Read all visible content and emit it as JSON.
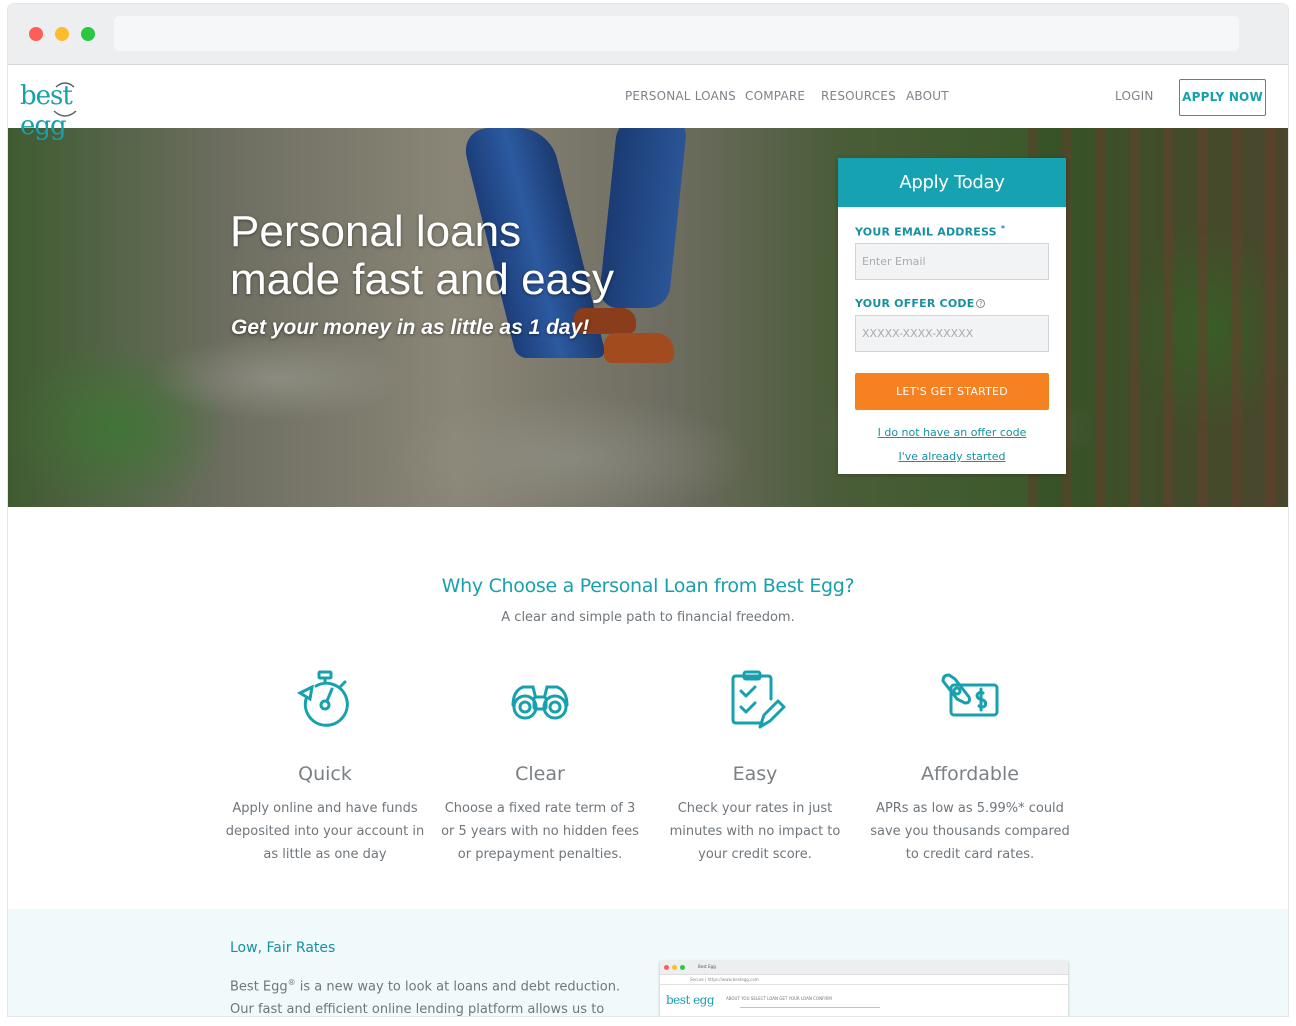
{
  "browser": {
    "url": ""
  },
  "brand": {
    "logo_text": "best egg",
    "accent": "#17a0ad",
    "cta_orange": "#f68121"
  },
  "nav": {
    "items": [
      "PERSONAL LOANS",
      "COMPARE",
      "RESOURCES",
      "ABOUT"
    ],
    "login": "LOGIN",
    "apply": "APPLY NOW"
  },
  "hero": {
    "headline_line1": "Personal loans",
    "headline_line2": "made fast and easy",
    "subheadline": "Get your money in as little as 1 day!"
  },
  "apply_form": {
    "title": "Apply Today",
    "email_label": "YOUR EMAIL ADDRESS",
    "email_required_mark": "*",
    "email_placeholder": "Enter Email",
    "offer_label": "YOUR OFFER CODE",
    "offer_help_glyph": "?",
    "offer_placeholder": "XXXXX-XXXX-XXXXX",
    "submit": "LET'S GET STARTED",
    "link_no_code": "I do not have an offer code",
    "link_started": "I've already started"
  },
  "why": {
    "title": "Why Choose a Personal Loan from Best Egg?",
    "tagline": "A clear and simple path to financial freedom.",
    "features": [
      {
        "icon": "stopwatch-icon",
        "title": "Quick",
        "text": "Apply online and have funds deposited into your account in as little as one day"
      },
      {
        "icon": "binoculars-icon",
        "title": "Clear",
        "text": "Choose a fixed rate term of 3 or 5 years with no hidden fees or prepayment penalties."
      },
      {
        "icon": "clipboard-check-icon",
        "title": "Easy",
        "text": "Check your rates in just minutes with no impact to your credit score."
      },
      {
        "icon": "money-tag-icon",
        "title": "Affordable",
        "text": "APRs as low as 5.99%* could save you thousands compared to credit card rates."
      }
    ]
  },
  "rates": {
    "title": "Low, Fair Rates",
    "text_brand": "Best Egg",
    "text_mark": "®",
    "text_rest": " is a new way to look at loans and debt reduction. Our fast and efficient online lending platform allows us to make our",
    "mini_tab": "Best Egg",
    "mini_url": "Secure | https://www.bestegg.com",
    "mini_logo": "best egg",
    "mini_steps": "ABOUT YOU      SELECT LOAN      GET YOUR LOAN      CONFIRM"
  }
}
